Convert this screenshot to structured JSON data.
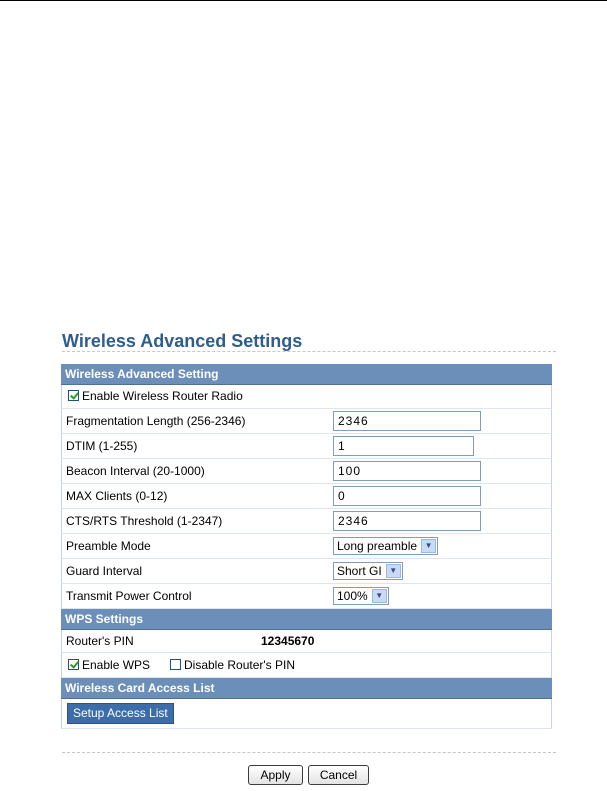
{
  "page": {
    "title": "Wireless Advanced Settings"
  },
  "advanced": {
    "header": "Wireless Advanced Setting",
    "enable_radio_label": "Enable Wireless Router Radio",
    "fragmentation": {
      "label": "Fragmentation Length (256-2346)",
      "value": "2346"
    },
    "dtim": {
      "label": "DTIM (1-255)",
      "value": "1"
    },
    "beacon": {
      "label": "Beacon Interval (20-1000)",
      "value": "100"
    },
    "max_clients": {
      "label": "MAX Clients (0-12)",
      "value": "0"
    },
    "cts_rts": {
      "label": "CTS/RTS Threshold (1-2347)",
      "value": "2346"
    },
    "preamble": {
      "label": "Preamble Mode",
      "value": "Long preamble"
    },
    "guard": {
      "label": "Guard Interval",
      "value": "Short GI"
    },
    "tx_power": {
      "label": "Transmit Power Control",
      "value": "100%"
    }
  },
  "wps": {
    "header": "WPS Settings",
    "pin_label": "Router's PIN",
    "pin_value": "12345670",
    "enable_wps_label": "Enable WPS",
    "disable_pin_label": "Disable Router's PIN"
  },
  "access": {
    "header": "Wireless Card Access List",
    "setup_button": "Setup Access List"
  },
  "footer": {
    "apply": "Apply",
    "cancel": "Cancel"
  },
  "colors": {
    "header_bg": "#6c8fb9",
    "title": "#2f5d8e",
    "accent_button": "#3d6da8"
  }
}
